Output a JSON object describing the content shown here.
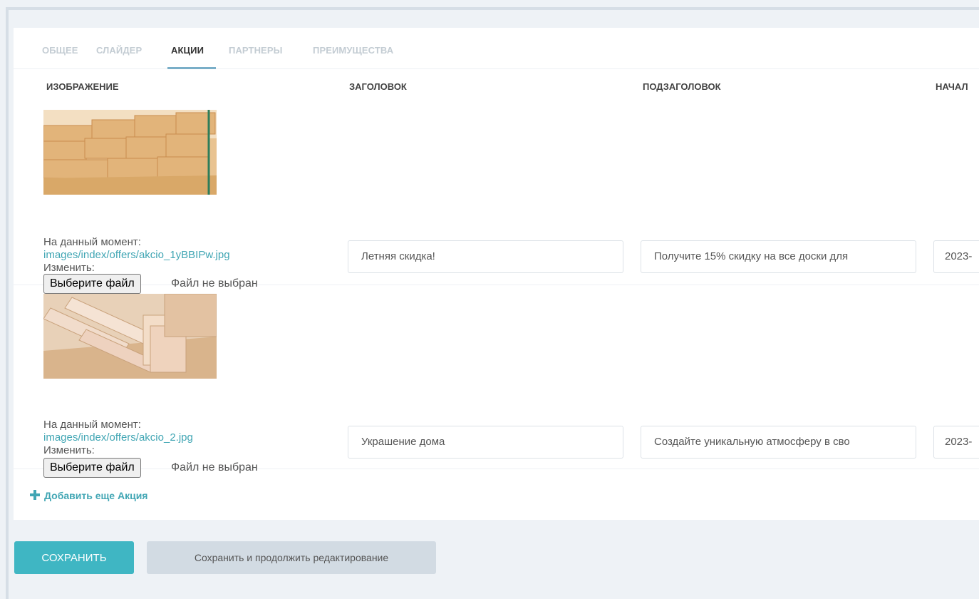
{
  "tabs": [
    {
      "label": "ОБЩЕЕ"
    },
    {
      "label": "СЛАЙДЕР"
    },
    {
      "label": "АКЦИИ"
    },
    {
      "label": "ПАРТНЕРЫ"
    },
    {
      "label": "ПРЕИМУЩЕСТВА"
    }
  ],
  "active_tab": "АКЦИИ",
  "columns": [
    "ИЗОБРАЖЕНИЕ",
    "ЗАГОЛОВОК",
    "ПОДЗАГОЛОВОК",
    "НАЧАЛ"
  ],
  "rows": [
    {
      "current_label": "На данный момент:",
      "current_file": "images/index/offers/akcio_1yBBIPw.jpg",
      "change_label": "Изменить:",
      "file_button": "Выберите файл",
      "file_status": "Файл не выбран",
      "title": "Летняя скидка!",
      "subtitle": "Получите 15% скидку на все доски для",
      "start": "2023-"
    },
    {
      "current_label": "На данный момент:",
      "current_file": "images/index/offers/akcio_2.jpg",
      "change_label": "Изменить:",
      "file_button": "Выберите файл",
      "file_status": "Файл не выбран",
      "title": "Украшение дома",
      "subtitle": "Создайте уникальную атмосферу в сво",
      "start": "2023-"
    }
  ],
  "add_link": "Добавить еще Акция",
  "buttons": {
    "save": "СОХРАНИТЬ",
    "save_continue": "Сохранить и продолжить редактирование"
  },
  "colors": {
    "accent": "#41a6b4",
    "save_button": "#3fb6c3",
    "secondary_button": "#d2dbe3",
    "active_tab_underline": "#79aec8"
  }
}
